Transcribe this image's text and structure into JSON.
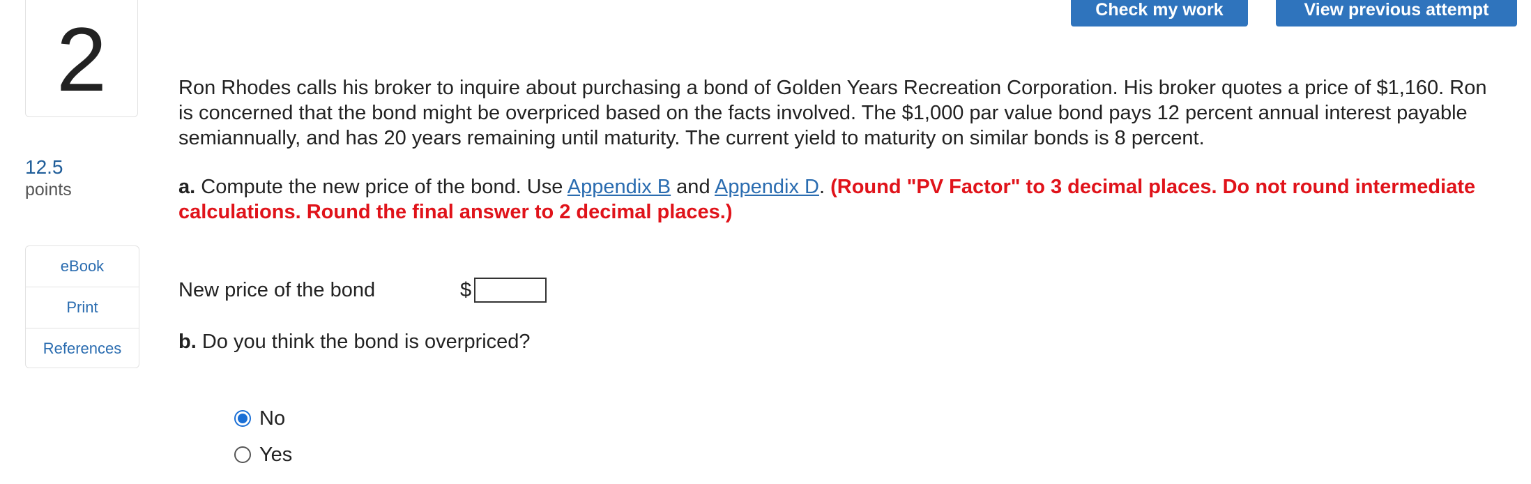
{
  "question": {
    "number": "2",
    "points_value": "12.5",
    "points_label": "points"
  },
  "resources": [
    {
      "label": "eBook"
    },
    {
      "label": "Print"
    },
    {
      "label": "References"
    }
  ],
  "buttons": {
    "check_work": "Check my work",
    "view_previous": "View previous attempt"
  },
  "problem": {
    "text": "Ron Rhodes calls his broker to inquire about purchasing a bond of Golden Years Recreation Corporation. His broker quotes a price of $1,160. Ron is concerned that the bond might be overpriced based on the facts involved. The $1,000 par value bond pays 12 percent annual interest payable semiannually, and has 20 years remaining until maturity. The current yield to maturity on similar bonds is 8 percent."
  },
  "part_a": {
    "label": "a.",
    "text_before": " Compute the new price of the bond. Use ",
    "link1": "Appendix B",
    "text_mid": " and ",
    "link2": "Appendix D",
    "text_after": ". ",
    "note": "(Round \"PV Factor\" to 3 decimal places. Do not round intermediate calculations. Round the final answer to 2 decimal places.)",
    "answer_label": "New price of the bond",
    "currency": "$",
    "answer_value": ""
  },
  "part_b": {
    "label": "b.",
    "text": " Do you think the bond is overpriced?",
    "options": [
      {
        "label": "No",
        "selected": true
      },
      {
        "label": "Yes",
        "selected": false
      }
    ]
  }
}
